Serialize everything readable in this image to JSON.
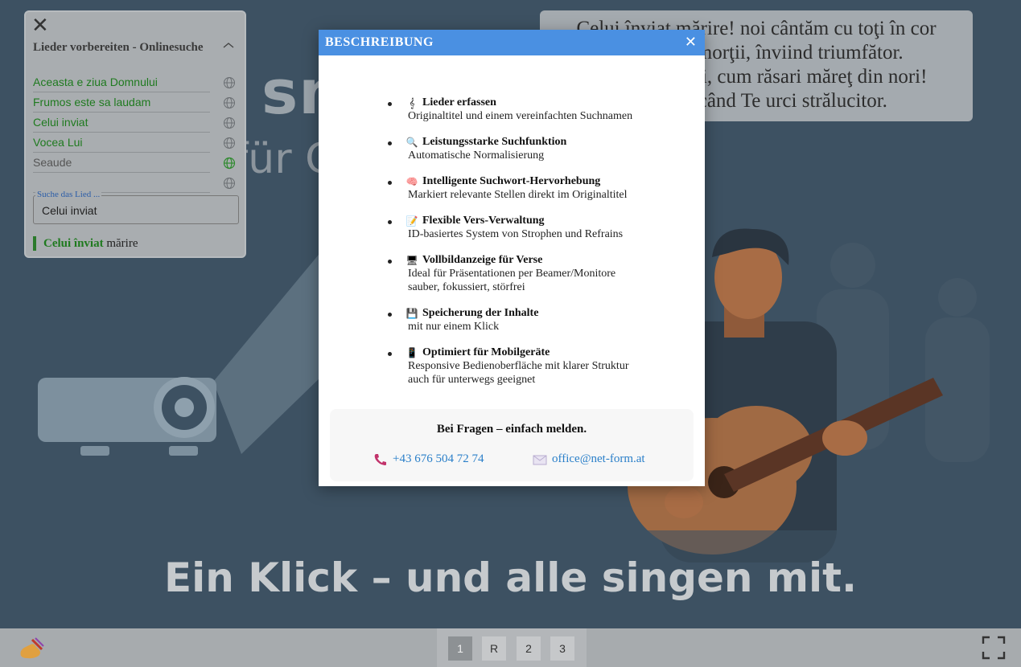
{
  "hero": {
    "big_text": "sm                ige",
    "mid_text": "für C                              eis",
    "bottom_text": "Ein Klick – und alle singen mit."
  },
  "verse": {
    "lines": [
      "Celui înviat mărire! noi cântăm cu toţi în cor",
      "ea morţii, înviind triumfător.",
      "ptăţii, cum răsari măreţ din nori!",
      "ipită când Te urci strălucitor."
    ]
  },
  "song_panel": {
    "title": "Lieder vorbereiten - Onlinesuche",
    "songs": [
      {
        "name": "Aceasta e ziua Domnului",
        "state": "found"
      },
      {
        "name": "Frumos este sa laudam",
        "state": "found"
      },
      {
        "name": "Celui inviat",
        "state": "found"
      },
      {
        "name": "Vocea Lui",
        "state": "found"
      },
      {
        "name": "Seaude",
        "state": "searching"
      },
      {
        "name": "",
        "state": "empty"
      }
    ],
    "search": {
      "legend": "Suche das Lied ...",
      "value": "Celui inviat"
    },
    "current": {
      "highlight": "Celui înviat",
      "rest": " mărire"
    }
  },
  "dialog": {
    "title": "BESCHREIBUNG",
    "features": [
      {
        "icon": "music-note-icon",
        "glyph": "𝄞",
        "title": "Lieder erfassen",
        "desc": [
          "Originaltitel und einem vereinfachten Suchnamen"
        ]
      },
      {
        "icon": "magnifier-icon",
        "glyph": "🔍",
        "title": "Leistungsstarke Suchfunktion",
        "desc": [
          "Automatische Normalisierung"
        ]
      },
      {
        "icon": "brain-icon",
        "glyph": "🧠",
        "title": "Intelligente Suchwort-Hervorhebung",
        "desc": [
          "Markiert relevante Stellen direkt im Originaltitel"
        ]
      },
      {
        "icon": "memo-icon",
        "glyph": "📝",
        "title": "Flexible Vers-Verwaltung",
        "desc": [
          "ID-basiertes System von Strophen und Refrains"
        ]
      },
      {
        "icon": "monitor-icon",
        "glyph": "🖥",
        "title": "Vollbildanzeige für Verse",
        "desc": [
          "Ideal für Präsentationen per Beamer/Monitore",
          "sauber, fokussiert, störfrei"
        ]
      },
      {
        "icon": "floppy-disk-icon",
        "glyph": "💾",
        "title": "Speicherung der Inhalte",
        "desc": [
          "mit nur einem Klick"
        ]
      },
      {
        "icon": "mobile-phone-icon",
        "glyph": "📱",
        "title": "Optimiert für Mobilgeräte",
        "desc": [
          "Responsive Bedienoberfläche mit klarer Struktur",
          "auch für unterwegs geeignet"
        ]
      }
    ],
    "contact": {
      "question": "Bei Fragen – einfach melden.",
      "phone": "+43 676 504 72 74",
      "email": "office@net-form.at"
    }
  },
  "pager": {
    "pages": [
      "1",
      "R",
      "2",
      "3"
    ],
    "active": "1"
  },
  "colors": {
    "accent": "#4a90e2",
    "link": "#2a7fc9",
    "song_found": "#1f7a1f"
  }
}
